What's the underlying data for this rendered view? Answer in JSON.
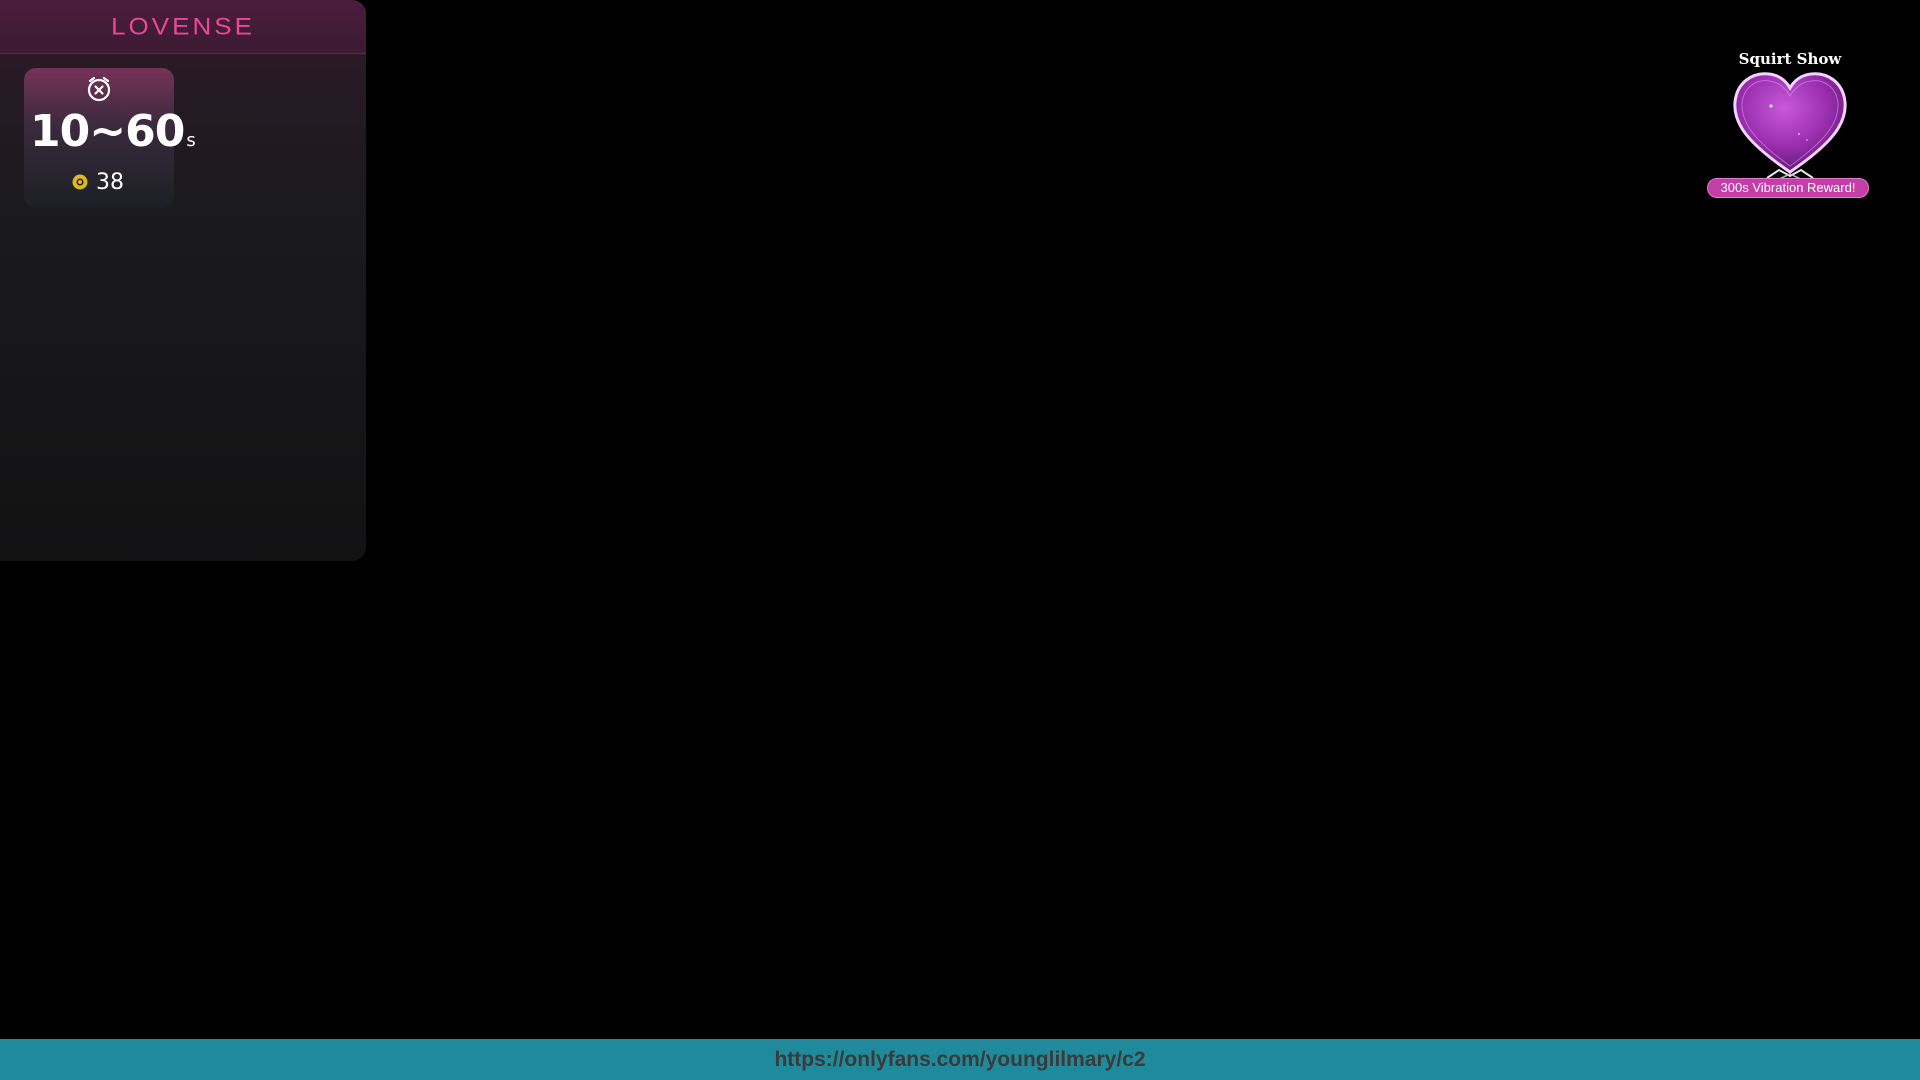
{
  "lovense": {
    "logo": "LOVENSE",
    "level": {
      "icon": "alarm-clock-icon",
      "range": "10~60",
      "unit": "s",
      "coin_icon": "coin-icon",
      "tokens": "38"
    }
  },
  "squirt_show": {
    "title": "Squirt Show",
    "icon": "heart-icon",
    "reward_label": "300s Vibration Reward!"
  },
  "banner": {
    "url": "https://onlyfans.com/younglilmary/c2"
  },
  "colors": {
    "brand_pink": "#e8479a",
    "banner_teal": "#1e8a9c",
    "reward_pill": "#c43ea8",
    "coin_gold": "#e0b81c"
  }
}
